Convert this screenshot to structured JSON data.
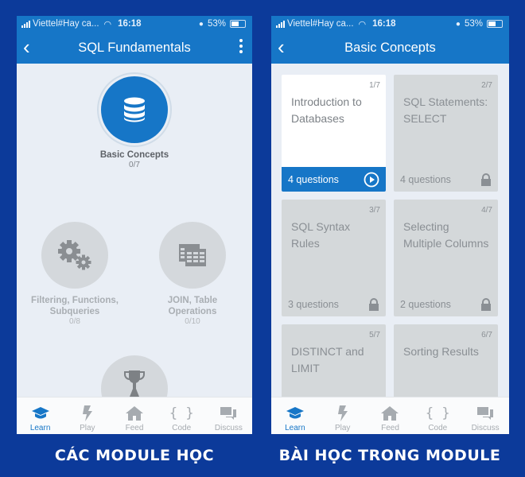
{
  "colors": {
    "brand_blue": "#1676c7",
    "background": "#0c3a9a",
    "locked_card": "#d4d8da"
  },
  "status_bar": {
    "carrier": "Viettel#Hay ca...",
    "time": "16:18",
    "battery": "53%"
  },
  "left_screen": {
    "title": "SQL Fundamentals",
    "back_icon": "chevron-left-icon",
    "menu_icon": "more-vertical-icon",
    "modules": [
      {
        "title": "Basic Concepts",
        "progress": "0/7",
        "icon": "database-icon",
        "state": "active"
      },
      {
        "title": "Filtering, Functions, Subqueries",
        "progress": "0/8",
        "icon": "gears-icon",
        "state": "locked"
      },
      {
        "title": "JOIN, Table Operations",
        "progress": "0/10",
        "icon": "table-icon",
        "state": "locked"
      },
      {
        "title": "",
        "progress": "",
        "icon": "trophy-icon",
        "state": "locked"
      }
    ]
  },
  "right_screen": {
    "title": "Basic Concepts",
    "back_icon": "chevron-left-icon",
    "lessons": [
      {
        "index": "1/7",
        "title": "Introduction to Databases",
        "questions": "4 questions",
        "state": "unlocked",
        "icon": "play-icon"
      },
      {
        "index": "2/7",
        "title": "SQL Statements: SELECT",
        "questions": "4 questions",
        "state": "locked",
        "icon": "lock-icon"
      },
      {
        "index": "3/7",
        "title": "SQL Syntax Rules",
        "questions": "3 questions",
        "state": "locked",
        "icon": "lock-icon"
      },
      {
        "index": "4/7",
        "title": "Selecting Multiple Columns",
        "questions": "2 questions",
        "state": "locked",
        "icon": "lock-icon"
      },
      {
        "index": "5/7",
        "title": "DISTINCT and LIMIT",
        "questions": "",
        "state": "locked",
        "icon": ""
      },
      {
        "index": "6/7",
        "title": "Sorting Results",
        "questions": "",
        "state": "locked",
        "icon": ""
      }
    ]
  },
  "tab_bar": {
    "items": [
      {
        "label": "Learn",
        "icon": "graduation-cap-icon",
        "active": true
      },
      {
        "label": "Play",
        "icon": "lightning-icon",
        "active": false
      },
      {
        "label": "Feed",
        "icon": "home-icon",
        "active": false
      },
      {
        "label": "Code",
        "icon": "braces-icon",
        "active": false
      },
      {
        "label": "Discuss",
        "icon": "chat-icon",
        "active": false
      }
    ]
  },
  "captions": {
    "left": "CÁC MODULE HỌC",
    "right": "BÀI HỌC TRONG MODULE"
  }
}
